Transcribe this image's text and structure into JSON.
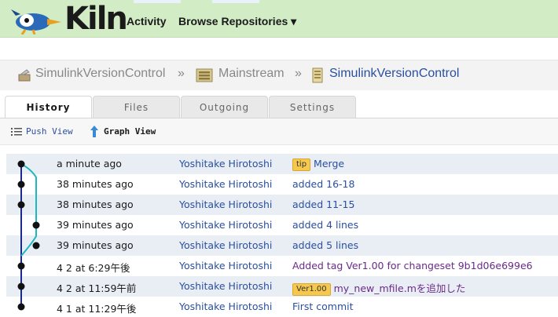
{
  "header": {
    "brand": "Kiln",
    "nav": [
      "Activity",
      "Browse Repositories ▾"
    ]
  },
  "breadcrumb": {
    "items": [
      "SimulinkVersionControl",
      "Mainstream",
      "SimulinkVersionControl"
    ],
    "separator": "»"
  },
  "tabs": [
    "History",
    "Files",
    "Outgoing",
    "Settings"
  ],
  "views": [
    "Push View",
    "Graph View"
  ],
  "changesets": [
    {
      "time": "a minute ago",
      "author": "Yoshitake Hirotoshi",
      "badge": "tip",
      "desc": "Merge"
    },
    {
      "time": "38 minutes ago",
      "author": "Yoshitake Hirotoshi",
      "badge": "",
      "desc": "added 16-18"
    },
    {
      "time": "38 minutes ago",
      "author": "Yoshitake Hirotoshi",
      "badge": "",
      "desc": "added 11-15"
    },
    {
      "time": "39 minutes ago",
      "author": "Yoshitake Hirotoshi",
      "badge": "",
      "desc": "added 4 lines"
    },
    {
      "time": "39 minutes ago",
      "author": "Yoshitake Hirotoshi",
      "badge": "",
      "desc": "added 5 lines"
    },
    {
      "time": "4 2 at 6:29午後",
      "author": "Yoshitake Hirotoshi",
      "badge": "",
      "desc": "Added tag Ver1.00 for changeset 9b1d06e699e6"
    },
    {
      "time": "4 2 at 11:59午前",
      "author": "Yoshitake Hirotoshi",
      "badge": "Ver1.00",
      "desc": "my_new_mfile.mを追加した"
    },
    {
      "time": "4 1 at 11:29午後",
      "author": "Yoshitake Hirotoshi",
      "badge": "",
      "desc": "First commit"
    }
  ],
  "colors": {
    "header_bg": "#d2ecc6",
    "link": "#2a4fa0",
    "branch_main": "#1a2a8a",
    "branch_side": "#1fb8c0",
    "badge": "#f6c84d",
    "row_alt": "#e9eef5"
  },
  "icons": [
    "kiln-logo-icon",
    "repo-icon",
    "repo-group-icon",
    "file-icon",
    "list-icon",
    "graph-icon"
  ]
}
